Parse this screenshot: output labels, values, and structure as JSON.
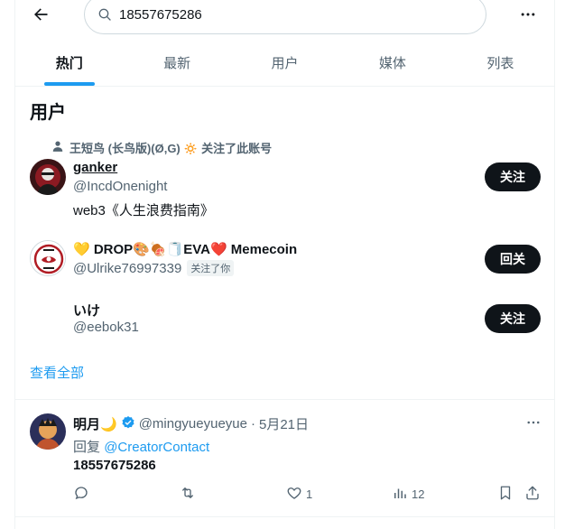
{
  "search": {
    "value": "18557675286"
  },
  "tabs": [
    {
      "label": "热门"
    },
    {
      "label": "最新"
    },
    {
      "label": "用户"
    },
    {
      "label": "媒体"
    },
    {
      "label": "列表"
    }
  ],
  "section_title": "用户",
  "users": [
    {
      "social_context": "王短鸟 (长鸟版)(Ø,G) 🔅 关注了此账号",
      "name": "ganker",
      "handle": "@IncdOnenight",
      "bio": "web3《人生浪费指南》",
      "button": "关注"
    },
    {
      "name": "💛 DROP🎨🍖🧻EVA❤️ Memecoin",
      "handle": "@Ulrike76997339",
      "follows_you": "关注了你",
      "button": "回关"
    },
    {
      "name": "いけ",
      "handle": "@eebok31",
      "button": "关注"
    }
  ],
  "show_all": "查看全部",
  "tweet": {
    "name": "明月🌙",
    "handle": "@mingyueyueyue",
    "separator": "·",
    "date": "5月21日",
    "reply_prefix": "回复",
    "reply_to": "@CreatorContact",
    "text": "18557675286",
    "likes": "1",
    "views": "12"
  },
  "colors": {
    "accent": "#1d9bf0",
    "text": "#0f1419",
    "muted": "#536471",
    "verified": "#1d9bf0"
  },
  "icons": [
    "back-arrow-icon",
    "search-icon",
    "more-icon",
    "person-icon",
    "verified-icon",
    "reply-icon",
    "retweet-icon",
    "like-icon",
    "views-icon",
    "bookmark-icon",
    "share-icon"
  ]
}
